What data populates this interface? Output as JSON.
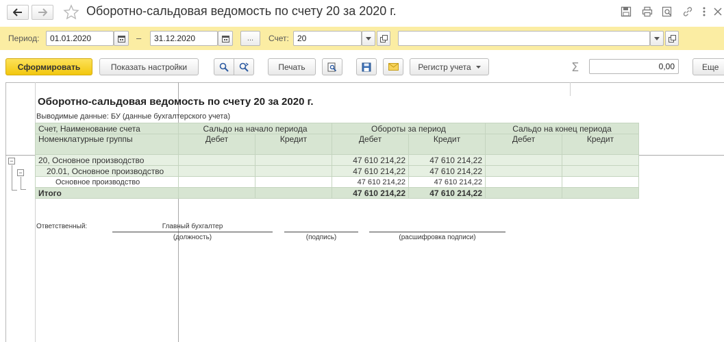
{
  "window": {
    "title": "Оборотно-сальдовая ведомость по счету 20 за 2020 г."
  },
  "icons": {
    "back": "arrow-left-icon",
    "forward": "arrow-right-icon",
    "favorite": "star-icon",
    "save": "floppy-icon",
    "print": "printer-icon",
    "preview": "print-preview-icon",
    "search": "magnifier-icon",
    "link": "link-icon",
    "more": "kebab-icon",
    "close": "close-icon"
  },
  "period_bar": {
    "period_label": "Период:",
    "date_from": "01.01.2020",
    "dash": "–",
    "date_to": "31.12.2020",
    "select_period_label": "...",
    "account_label": "Счет:",
    "account_value": "20",
    "subconto_value": ""
  },
  "toolbar": {
    "generate_label": "Сформировать",
    "settings_label": "Показать настройки",
    "print_label": "Печать",
    "register_label": "Регистр учета",
    "sum_value": "0,00",
    "more_label": "Еще"
  },
  "report": {
    "title": "Оборотно-сальдовая ведомость по счету 20 за 2020 г.",
    "subtitle": "Выводимые данные:  БУ (данные бухгалтерского учета)",
    "headers": {
      "account": "Счет, Наименование счета",
      "nomenclature": "Номенклатурные группы",
      "opening": "Сальдо на начало периода",
      "turnover": "Обороты за период",
      "closing": "Сальдо на конец периода",
      "debit": "Дебет",
      "credit": "Кредит"
    },
    "rows": [
      {
        "name": "20, Основное производство",
        "open_dt": "",
        "open_kt": "",
        "turn_dt": "47 610 214,22",
        "turn_kt": "47 610 214,22",
        "close_dt": "",
        "close_kt": ""
      },
      {
        "name": "20.01, Основное производство",
        "open_dt": "",
        "open_kt": "",
        "turn_dt": "47 610 214,22",
        "turn_kt": "47 610 214,22",
        "close_dt": "",
        "close_kt": ""
      },
      {
        "name": "Основное производство",
        "open_dt": "",
        "open_kt": "",
        "turn_dt": "47 610 214,22",
        "turn_kt": "47 610 214,22",
        "close_dt": "",
        "close_kt": ""
      }
    ],
    "total": {
      "name": "Итого",
      "open_dt": "",
      "open_kt": "",
      "turn_dt": "47 610 214,22",
      "turn_kt": "47 610 214,22",
      "close_dt": "",
      "close_kt": ""
    },
    "signature": {
      "responsible_label": "Ответственный:",
      "position_value": "Главный бухгалтер",
      "position_caption": "(должность)",
      "signature_caption": "(подпись)",
      "decoding_caption": "(расшифровка подписи)"
    }
  },
  "colors": {
    "period_bar_bg": "#fbeda3",
    "primary_button": "#f2c70e",
    "table_header_bg": "#d7e5d2",
    "group_row_bg": "#e6f0e2"
  }
}
